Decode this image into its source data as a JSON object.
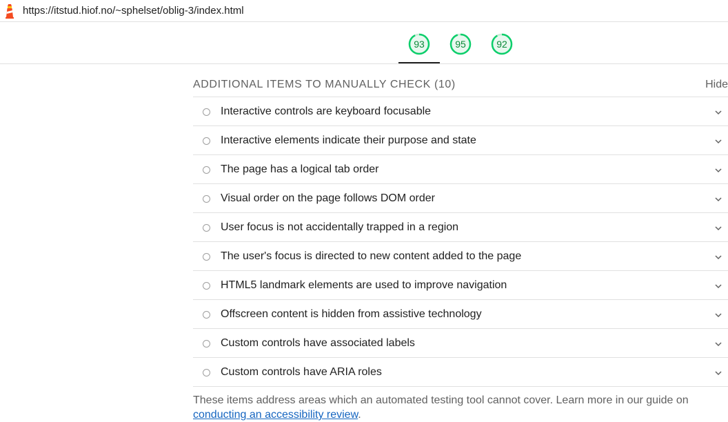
{
  "browser": {
    "url": "https://itstud.hiof.no/~sphelset/oblig-3/index.html",
    "logo_icon": "lighthouse-icon"
  },
  "gauges": [
    {
      "score": "93",
      "color": "#0cce6b"
    },
    {
      "score": "95",
      "color": "#0cce6b"
    },
    {
      "score": "92",
      "color": "#0cce6b"
    }
  ],
  "manual_section": {
    "title": "ADDITIONAL ITEMS TO MANUALLY CHECK (10)",
    "hide_label": "Hide",
    "items": [
      {
        "label": "Interactive controls are keyboard focusable"
      },
      {
        "label": "Interactive elements indicate their purpose and state"
      },
      {
        "label": "The page has a logical tab order"
      },
      {
        "label": "Visual order on the page follows DOM order"
      },
      {
        "label": "User focus is not accidentally trapped in a region"
      },
      {
        "label": "The user's focus is directed to new content added to the page"
      },
      {
        "label": "HTML5 landmark elements are used to improve navigation"
      },
      {
        "label": "Offscreen content is hidden from assistive technology"
      },
      {
        "label": "Custom controls have associated labels"
      },
      {
        "label": "Custom controls have ARIA roles"
      }
    ],
    "footer_text": "These items address areas which an automated testing tool cannot cover. Learn more in our guide on ",
    "footer_link": "conducting an accessibility review",
    "footer_end": "."
  }
}
